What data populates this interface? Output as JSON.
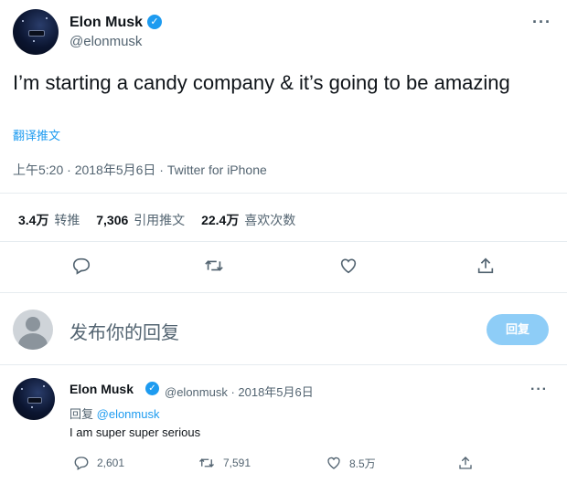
{
  "tweet": {
    "author_name": "Elon Musk",
    "author_handle": "@elonmusk",
    "verified_mark": "✓",
    "more_label": "···",
    "text": "I’m starting a candy company & it’s going to be amazing",
    "translate_label": "翻译推文",
    "meta": "上午5:20 · 2018年5月6日 · Twitter for iPhone",
    "stats": [
      {
        "value": "3.4万",
        "label": "转推"
      },
      {
        "value": "7,306",
        "label": "引用推文"
      },
      {
        "value": "22.4万",
        "label": "喜欢次数"
      }
    ],
    "actions": [
      "reply-icon",
      "retweet-icon",
      "like-icon",
      "share-icon"
    ]
  },
  "composer": {
    "placeholder": "发布你的回复",
    "button_label": "回复"
  },
  "reply": {
    "author_name": "Elon Musk",
    "verified_mark": "✓",
    "handle_date": "@elonmusk · 2018年5月6日",
    "more_label": "···",
    "replying_prefix": "回复",
    "replying_to": "@elonmusk",
    "text": "I am super super serious",
    "counts": {
      "replies": "2,601",
      "retweets": "7,591",
      "likes": "8.5万"
    }
  },
  "colors": {
    "accent": "#1d9bf0",
    "secondary_text": "#536471",
    "reply_button_disabled": "#8ecdf7"
  }
}
